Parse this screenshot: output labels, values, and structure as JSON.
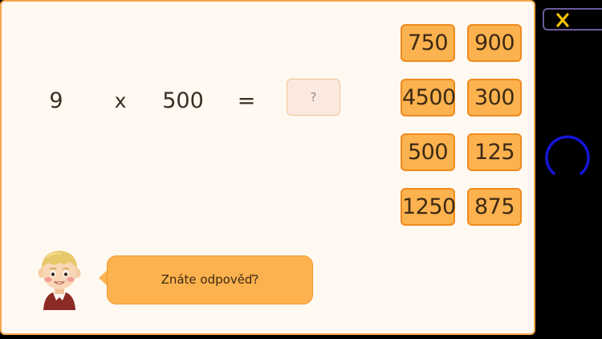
{
  "equation": {
    "operand_a": "9",
    "operator": "x",
    "operand_b": "500",
    "equals": "=",
    "answer_placeholder": "?"
  },
  "options": [
    "750",
    "900",
    "4500",
    "300",
    "500",
    "125",
    "1250",
    "875"
  ],
  "speech_bubble": {
    "text": "Znáte odpověď?"
  },
  "icons": {
    "close": "close-icon",
    "loading": "loading-spinner-icon",
    "avatar": "boy-avatar-icon"
  },
  "colors": {
    "panel_background": "#fff9f1",
    "panel_border": "#f3a64a",
    "option_fill": "#fcb24e",
    "option_border": "#f08a1e",
    "answer_box_fill": "#fbe9df",
    "close_icon": "#f5c400",
    "spinner": "#1515d8"
  }
}
